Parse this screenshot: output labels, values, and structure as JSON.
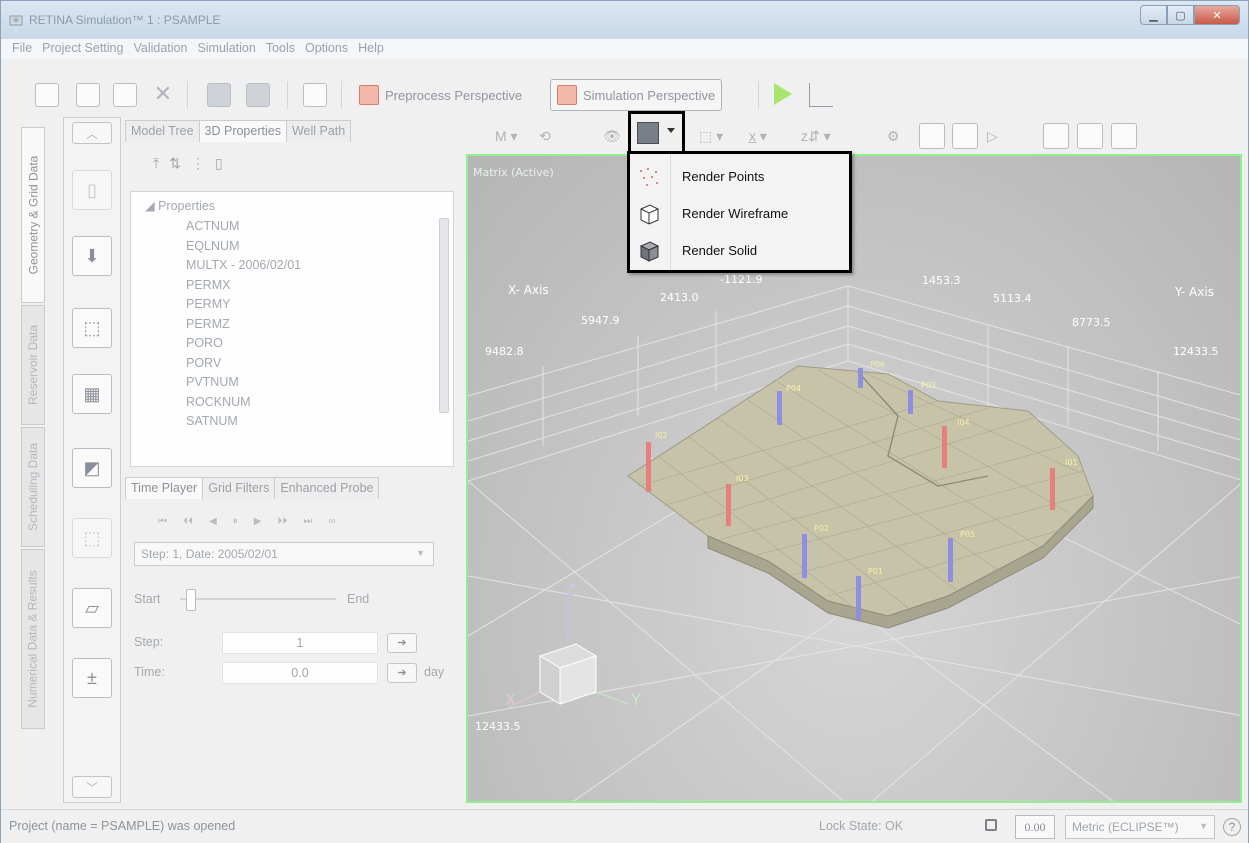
{
  "window": {
    "title": "RETINA Simulation™ 1 : PSAMPLE"
  },
  "menu": [
    "File",
    "Project Setting",
    "Validation",
    "Simulation",
    "Tools",
    "Options",
    "Help"
  ],
  "toolbar": {
    "preprocess_label": "Preprocess Perspective",
    "simulation_label": "Simulation Perspective"
  },
  "side_tabs": [
    "Geometry & Grid Data",
    "Reservoir Data",
    "Scheduling Data",
    "Numerical Data & Results"
  ],
  "left_panel": {
    "tabs": [
      "Model Tree",
      "3D Properties",
      "Well Path"
    ],
    "active_tab": "3D Properties",
    "tree_root": "Properties",
    "properties": [
      "ACTNUM",
      "EQLNUM",
      "MULTX - 2006/02/01",
      "PERMX",
      "PERMY",
      "PERMZ",
      "PORO",
      "PORV",
      "PVTNUM",
      "ROCKNUM",
      "SATNUM"
    ]
  },
  "bottom_panel": {
    "tabs": [
      "Time Player",
      "Grid Filters",
      "Enhanced Probe"
    ],
    "active_tab": "Time Player",
    "step_select": "Step: 1, Date: 2005/02/01",
    "start_label": "Start",
    "end_label": "End",
    "step_label": "Step:",
    "step_value": "1",
    "time_label": "Time:",
    "time_value": "0.0",
    "time_unit": "day"
  },
  "viewport": {
    "matrix_label": "Matrix (Active)",
    "x_axis_label": "X- Axis",
    "y_axis_label": "Y- Axis",
    "x_ticks": [
      "9482.8",
      "5947.9",
      "2413.0",
      "-1121.9"
    ],
    "y_ticks": [
      "1453.3",
      "5113.4",
      "8773.5",
      "12433.5"
    ],
    "depth_label": "12433.5",
    "wells": [
      "P06",
      "P04",
      "P03",
      "I02",
      "I04",
      "I03",
      "I01",
      "P02",
      "P05",
      "P01"
    ],
    "axis_z": "Z",
    "axis_y": "Y",
    "axis_x": "X"
  },
  "render_menu": {
    "items": [
      {
        "label": "Render Points",
        "icon": "render-points-icon"
      },
      {
        "label": "Render Wireframe",
        "icon": "render-wireframe-icon"
      },
      {
        "label": "Render Solid",
        "icon": "render-solid-icon"
      }
    ]
  },
  "statusbar": {
    "message": "Project (name = PSAMPLE) was opened",
    "lock_state": "Lock State: OK",
    "zoom": "0.00",
    "unit_system": "Metric (ECLIPSE™)"
  },
  "colors": {
    "viewport_border": "#8ef08e",
    "grid_surface": "#c7c3a8",
    "injector_well": "#e87f7f",
    "producer_well": "#8f8fe0"
  }
}
